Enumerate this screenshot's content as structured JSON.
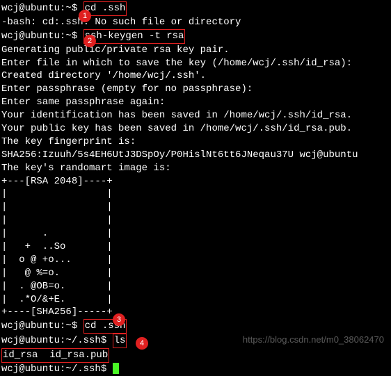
{
  "lines": {
    "l1_prompt": "wcj@ubuntu:~$ ",
    "l1_cmd": "cd .ssh",
    "l2": "-bash: cd:.ssh: No such file or directory",
    "l3_prompt": "wcj@ubuntu:~$ ",
    "l3_cmd": "ssh-keygen -t rsa",
    "l4": "Generating public/private rsa key pair.",
    "l5": "Enter file in which to save the key (/home/wcj/.ssh/id_rsa):",
    "l6": "Created directory '/home/wcj/.ssh'.",
    "l7": "Enter passphrase (empty for no passphrase):",
    "l8": "Enter same passphrase again:",
    "l9": "Your identification has been saved in /home/wcj/.ssh/id_rsa.",
    "l10": "Your public key has been saved in /home/wcj/.ssh/id_rsa.pub.",
    "l11": "The key fingerprint is:",
    "l12": "SHA256:Izuuh/5s4EH6UtJ3DSpOy/P0HislNt6tt6JNeqau37U wcj@ubuntu",
    "l13": "The key's randomart image is:",
    "r1": "+---[RSA 2048]----+",
    "r2": "|                 |",
    "r3": "|                 |",
    "r4": "|                 |",
    "r5": "|      .          |",
    "r6": "|   +  ..So       |",
    "r7": "|  o @ +o...      |",
    "r8": "|   @ %=o.        |",
    "r9": "|  . @OB=o.       |",
    "r10": "|  .*O/&+E.       |",
    "r11": "+----[SHA256]-----+",
    "l14_prompt": "wcj@ubuntu:~$ ",
    "l14_cmd": "cd .ssh",
    "l15_prompt": "wcj@ubuntu:~/.ssh$ ",
    "l15_cmd": "ls",
    "l16": "id_rsa  id_rsa.pub",
    "l17_prompt": "wcj@ubuntu:~/.ssh$ "
  },
  "badges": {
    "b1": "1",
    "b2": "2",
    "b3": "3",
    "b4": "4"
  },
  "watermark": "https://blog.csdn.net/m0_38062470"
}
